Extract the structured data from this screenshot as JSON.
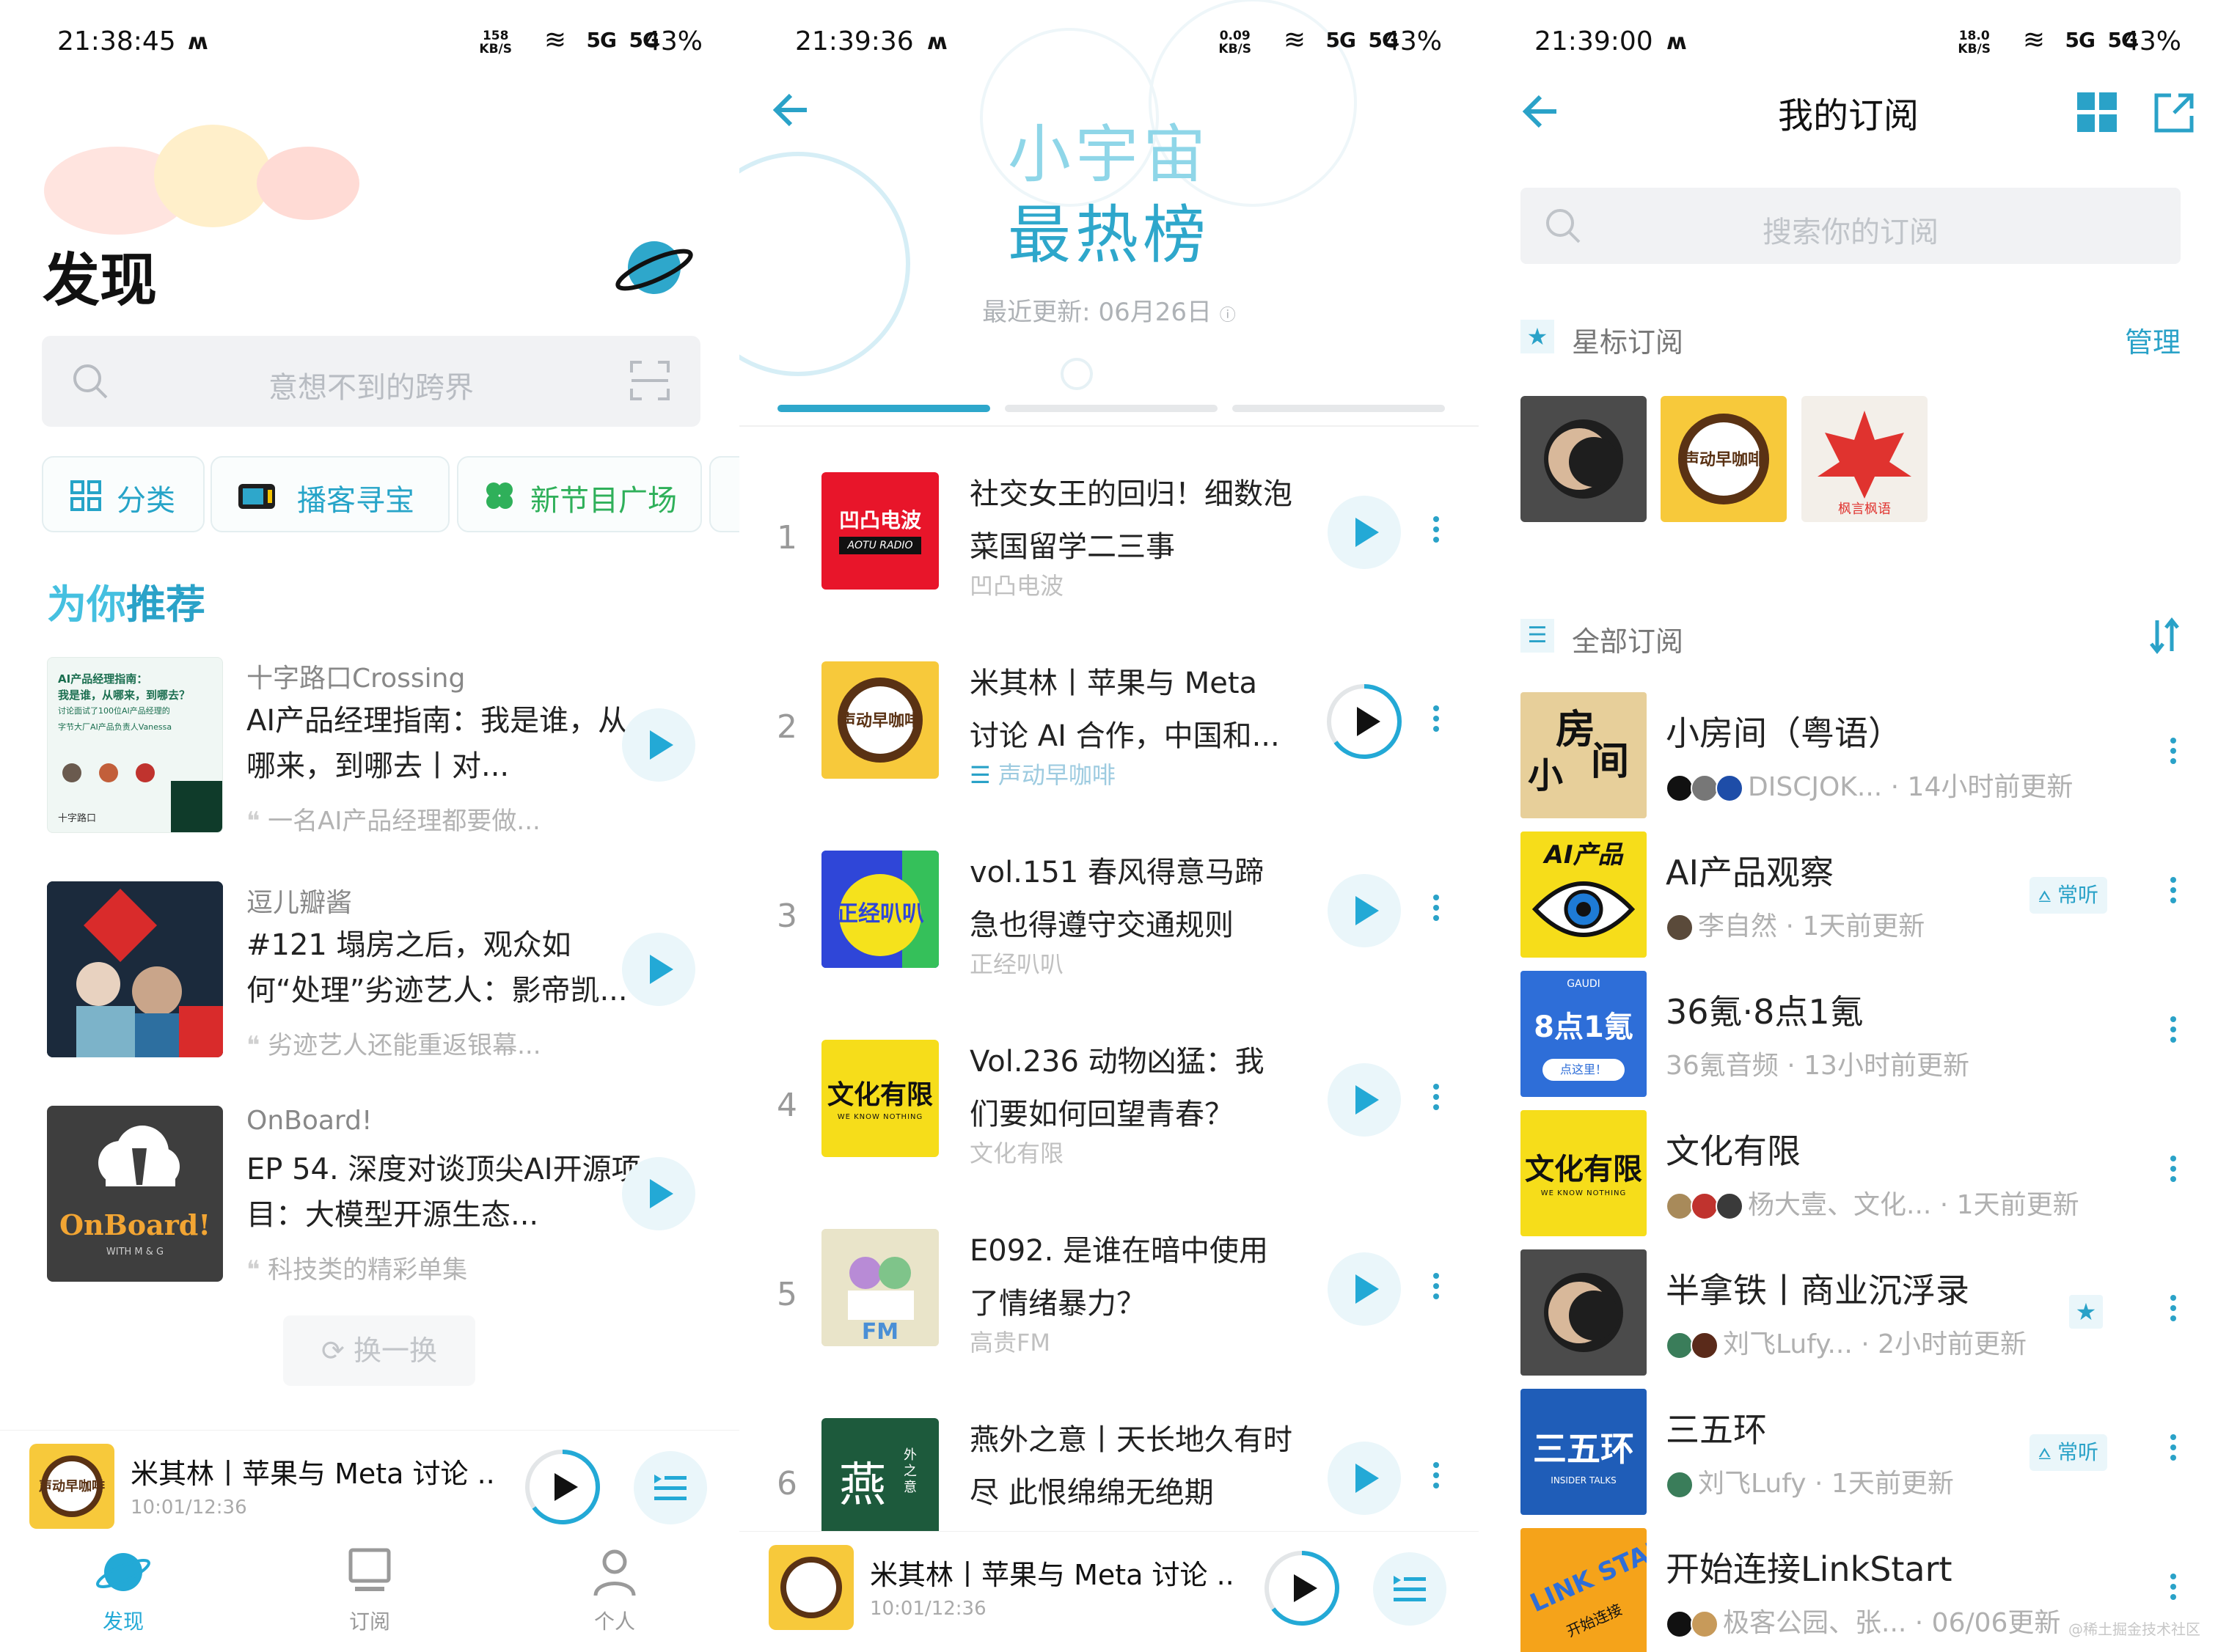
{
  "panel1": {
    "status": {
      "time": "21:38:45",
      "net_value": "158",
      "net_unit": "KB/S",
      "sig1": "5G",
      "sig2": "5G",
      "battery": "43%"
    },
    "title": "发现",
    "search": {
      "placeholder": "意想不到的跨界"
    },
    "chips": [
      {
        "label": "分类",
        "icon": "grid-icon"
      },
      {
        "label": "播客寻宝",
        "icon": "treasure-icon"
      },
      {
        "label": "新节目广场",
        "icon": "clover-icon"
      }
    ],
    "section_title_a": "为你",
    "section_title_b": "推荐",
    "recommendations": [
      {
        "source": "十字路口Crossing",
        "title": "AI产品经理指南：我是谁，从哪来，到哪去丨对...",
        "desc": "一名AI产品经理都要做...",
        "cover_lines": [
          "AI产品经理指南：",
          "我是谁，从哪来，到哪去？",
          "讨论面试了100位AI产品经理的",
          "字节大厂AI产品负责人Vanessa"
        ],
        "cover_brand": "十字路口"
      },
      {
        "source": "逗儿瓣酱",
        "title": "#121 塌房之后，观众如何“处理”劣迹艺人：影帝凯...",
        "desc": "劣迹艺人还能重返银幕..."
      },
      {
        "source": "OnBoard!",
        "title": "EP 54. 深度对谈顶尖AI开源项目：大模型开源生态...",
        "desc": "科技类的精彩单集",
        "cover_brand": "OnBoard!",
        "cover_sub": "WITH M & G"
      }
    ],
    "swap_label": "换一换",
    "mini_player": {
      "title": "米其林丨苹果与 Meta 讨论 ...",
      "time": "10:01/12:36"
    },
    "tabs": [
      {
        "label": "发现",
        "icon": "planet-icon"
      },
      {
        "label": "订阅",
        "icon": "monitor-icon"
      },
      {
        "label": "个人",
        "icon": "person-icon"
      }
    ]
  },
  "panel2": {
    "status": {
      "time": "21:39:36",
      "net_value": "0.09",
      "net_unit": "KB/S",
      "sig1": "5G",
      "sig2": "5G",
      "battery": "43%"
    },
    "title_line1": "小宇宙",
    "title_line2": "最热榜",
    "updated_label": "最近更新:",
    "updated_date": "06月26日",
    "ranks": [
      {
        "num": "1",
        "title": "社交女王的回归！细数泡菜国留学二三事",
        "source": "凹凸电波",
        "cover_text": "凹凸电波",
        "cover_sub": "AOTU RADIO"
      },
      {
        "num": "2",
        "title": "米其林丨苹果与 Meta 讨论 AI 合作，中国和...",
        "source": "声动早咖啡",
        "cover_text": "声动早咖啡"
      },
      {
        "num": "3",
        "title": "vol.151 春风得意马蹄急也得遵守交通规则",
        "source": "正经叭叭",
        "cover_text": "正经叭叭"
      },
      {
        "num": "4",
        "title": "Vol.236 动物凶猛：我们要如何回望青春？",
        "source": "文化有限",
        "cover_text": "文化有限",
        "cover_sub": "WE KNOW NOTHING"
      },
      {
        "num": "5",
        "title": "E092. 是谁在暗中使用了情绪暴力？",
        "source": "高贵FM",
        "cover_text": "FM"
      },
      {
        "num": "6",
        "title": "燕外之意丨天长地久有时尽 此恨绵绵无绝期",
        "source": "",
        "cover_text": "燕",
        "cover_sub": "外之意"
      }
    ],
    "mini_player": {
      "title": "米其林丨苹果与 Meta 讨论 ...",
      "time": "10:01/12:36"
    }
  },
  "panel3": {
    "status": {
      "time": "21:39:00",
      "net_value": "18.0",
      "net_unit": "KB/S",
      "sig1": "5G",
      "sig2": "5G",
      "battery": "43%"
    },
    "title": "我的订阅",
    "search": {
      "placeholder": "搜索你的订阅"
    },
    "starred_label": "星标订阅",
    "manage_label": "管理",
    "starred_covers": [
      {
        "name": "dark-circle"
      },
      {
        "name": "声动早咖啡"
      },
      {
        "name": "枫言枫语"
      }
    ],
    "all_label": "全部订阅",
    "subs": [
      {
        "title": "小房间（粤语）",
        "meta": "DISCJOK... · 14小时前更新",
        "cover_text": "房 间",
        "cover_sub": "小"
      },
      {
        "title": "AI产品观察",
        "meta": "李自然 · 1天前更新",
        "tag": "常听",
        "cover_text": "AI产品"
      },
      {
        "title": "36氪·8点1氪",
        "meta": "36氪音频 · 13小时前更新",
        "cover_text": "8点1氪",
        "cover_sub": "点这里！"
      },
      {
        "title": "文化有限",
        "meta": "杨大壹、文化... · 1天前更新",
        "cover_text": "文化有限",
        "cover_sub": "WE KNOW NOTHING"
      },
      {
        "title": "半拿铁丨商业沉浮录",
        "meta": "刘飞Lufy... · 2小时前更新",
        "star": true
      },
      {
        "title": "三五环",
        "meta": "刘飞Lufy · 1天前更新",
        "tag": "常听",
        "cover_text": "三五环",
        "cover_sub": "INSIDER TALKS"
      },
      {
        "title": "开始连接LinkStart",
        "meta": "极客公园、张... · 06/06更新",
        "cover_text": "LINK START",
        "cover_sub": "开始连接"
      }
    ],
    "watermark": "@稀土掘金技术社区"
  },
  "colors": {
    "accent": "#23a9d6",
    "accent_dark": "#2aa2c8",
    "light_bg": "#eaf6fa"
  }
}
